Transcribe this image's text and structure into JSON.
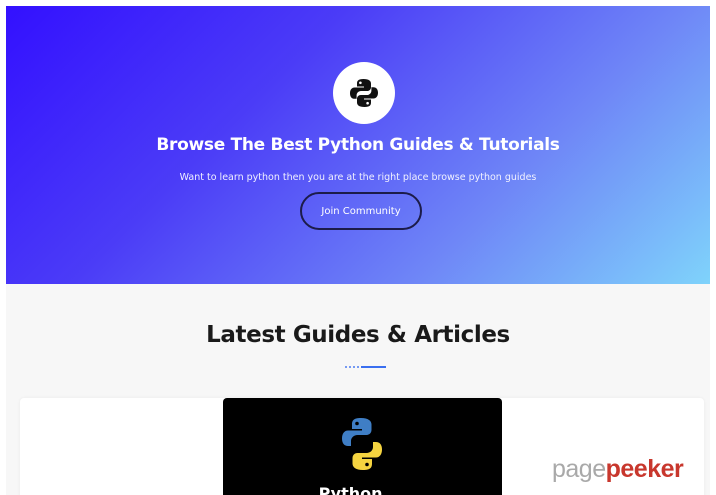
{
  "hero": {
    "logo_icon": "python-logo-icon",
    "title": "Browse The Best Python Guides & Tutorials",
    "subtitle": "Want to learn python then you are at the right place browse python guides",
    "join_button_label": "Join Community",
    "gradient_colors": [
      "#3310ff",
      "#6f87f7",
      "#7fd3fb"
    ]
  },
  "section": {
    "title": "Latest Guides & Articles",
    "divider_color": "#3a6ff0"
  },
  "card": {
    "image_icon": "python-logo-icon",
    "image_caption_partial": "Python ...",
    "image_background": "#000000"
  },
  "watermark": {
    "part1": "page",
    "part2": "peeker",
    "color1": "#a9a9a9",
    "color2": "#c8372d"
  }
}
